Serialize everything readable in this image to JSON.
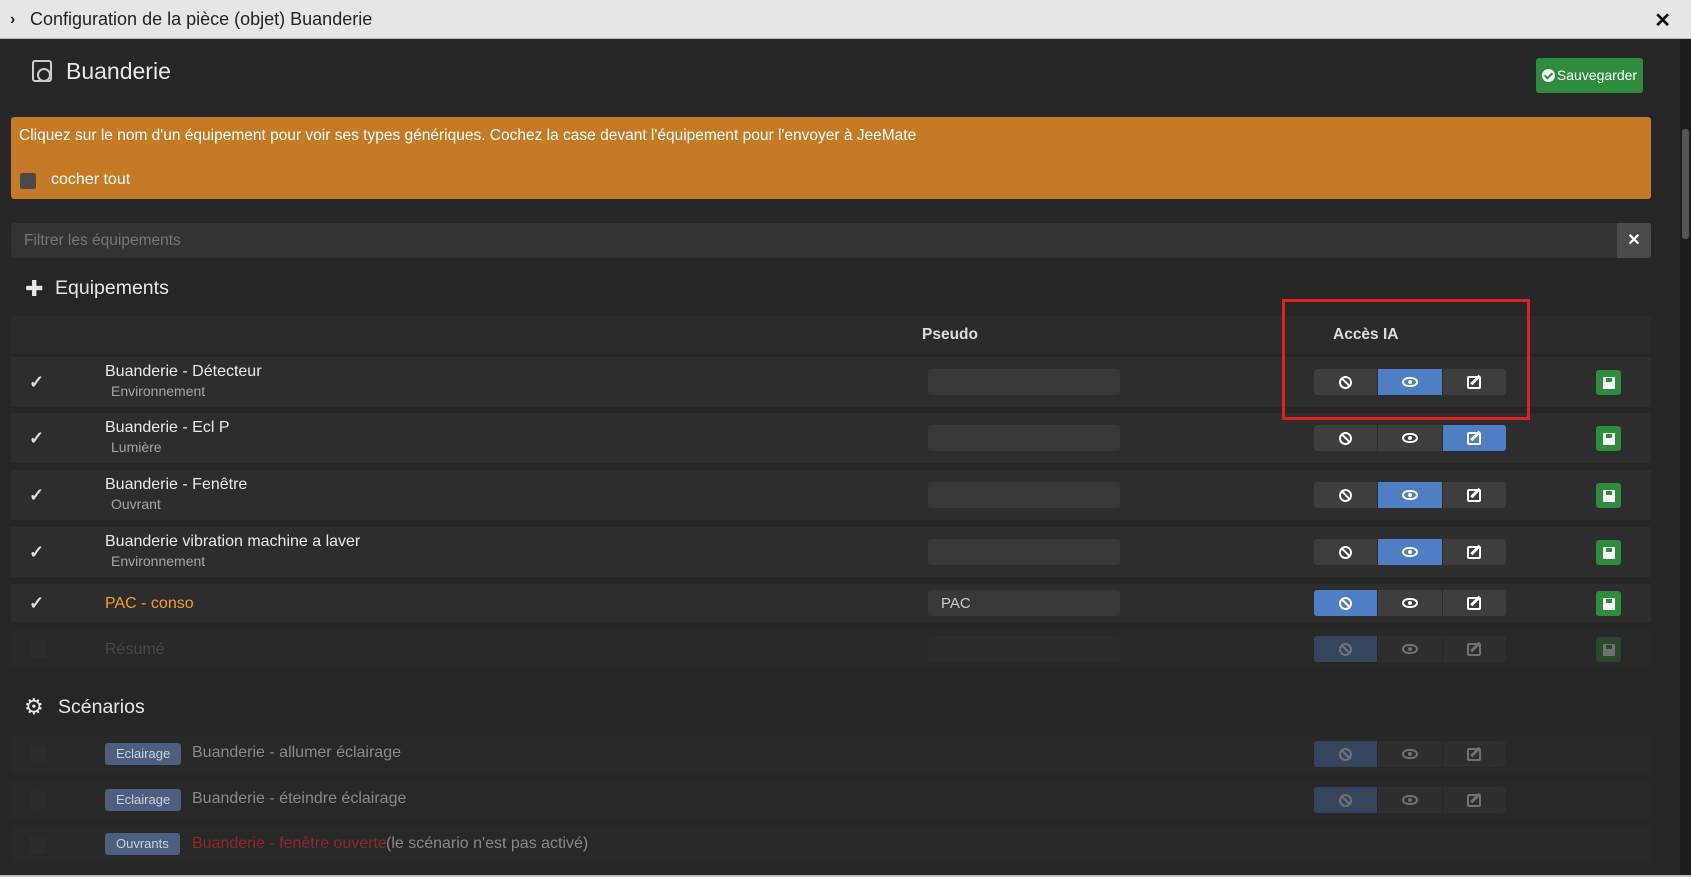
{
  "window": {
    "title": "Configuration de la pièce (objet) Buanderie"
  },
  "header": {
    "room_name": "Buanderie",
    "save_label": "Sauvegarder"
  },
  "alert": {
    "message": "Cliquez sur le nom d'un équipement pour voir ses types génériques. Cochez la case devant l'équipement pour l'envoyer à JeeMate",
    "check_all_label": "cocher tout"
  },
  "filter": {
    "placeholder": "Filtrer les équipements"
  },
  "equipements": {
    "title": "Equipements",
    "columns": {
      "pseudo": "Pseudo",
      "access": "Accès IA"
    },
    "rows": [
      {
        "name": "Buanderie - Détecteur",
        "category": "Environnement",
        "checked": true,
        "pseudo": "",
        "access": "view"
      },
      {
        "name": "Buanderie - Ecl P",
        "category": "Lumière",
        "checked": true,
        "pseudo": "",
        "access": "edit"
      },
      {
        "name": "Buanderie - Fenêtre",
        "category": "Ouvrant",
        "checked": true,
        "pseudo": "",
        "access": "view"
      },
      {
        "name": "Buanderie vibration machine a laver",
        "category": "Environnement",
        "checked": true,
        "pseudo": "",
        "access": "view"
      },
      {
        "name": "PAC - conso",
        "category": "",
        "checked": true,
        "pseudo": "PAC",
        "access": "none"
      },
      {
        "name": "Résumé",
        "category": "",
        "checked": false,
        "pseudo": "",
        "access": "none"
      }
    ]
  },
  "scenarios": {
    "title": "Scénarios",
    "rows": [
      {
        "badge": "Eclairage",
        "name": "Buanderie - allumer éclairage",
        "note": "",
        "active": true
      },
      {
        "badge": "Eclairage",
        "name": "Buanderie - éteindre éclairage",
        "note": "",
        "active": true
      },
      {
        "badge": "Ouvrants",
        "name": "Buanderie - fenêtre ouverte",
        "note": "(le scénario n'est pas activé)",
        "active": false
      }
    ]
  },
  "icons": {
    "title_chevron": "chevron-right-icon",
    "close": "close-icon",
    "room": "washing-machine-icon",
    "save": "check-circle-icon",
    "equipements": "puzzle-icon",
    "scenarios": "gears-icon",
    "access_none": "ban-icon",
    "access_view": "eye-icon",
    "access_edit": "edit-icon",
    "row_save": "floppy-icon"
  },
  "colors": {
    "panel_bg": "#262626",
    "alert_bg": "#c57a25",
    "save_green": "#2f8c3c",
    "active_blue": "#4e7fc4",
    "highlight_red": "#e32020",
    "pac_orange": "#f0a030",
    "disabled_scenario_red": "#8b2a2a"
  }
}
